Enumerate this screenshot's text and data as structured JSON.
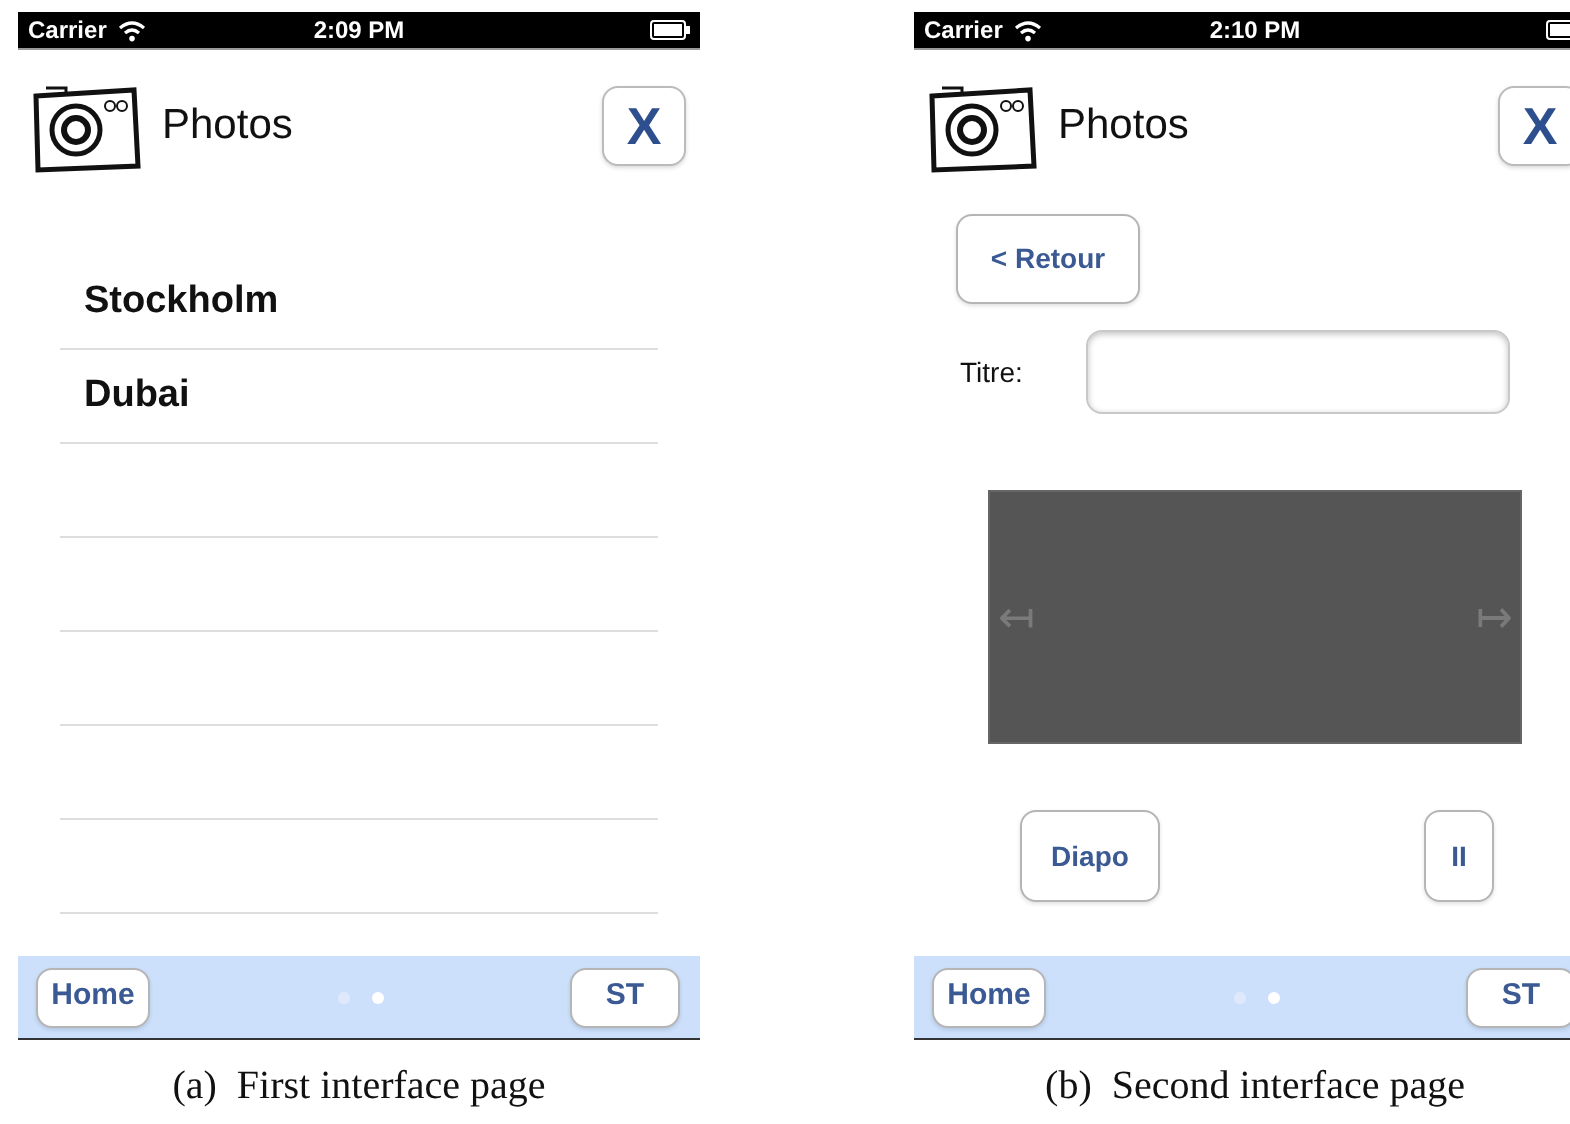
{
  "panels": [
    {
      "label": "(a)",
      "caption": "First interface page",
      "status": {
        "carrier": "Carrier",
        "time": "2:09 PM"
      },
      "header": {
        "title": "Photos",
        "close": "X"
      },
      "content": {
        "kind": "list",
        "rows": [
          "Stockholm",
          "Dubai"
        ]
      },
      "toolbar": {
        "left": "Home",
        "right": "ST",
        "page_dots": [
          {
            "selected": false
          },
          {
            "selected": true
          }
        ]
      }
    },
    {
      "label": "(b)",
      "caption": "Second interface page",
      "status": {
        "carrier": "Carrier",
        "time": "2:10 PM"
      },
      "header": {
        "title": "Photos",
        "close": "X"
      },
      "content": {
        "kind": "detail",
        "back": "< Retour",
        "field_label": "Titre:",
        "viewer": {
          "prev": "↤",
          "next": "↦"
        },
        "buttons": [
          "Diapo",
          "II"
        ]
      },
      "toolbar": {
        "left": "Home",
        "right": "ST",
        "page_dots": [
          {
            "selected": false
          },
          {
            "selected": true
          }
        ]
      }
    }
  ]
}
